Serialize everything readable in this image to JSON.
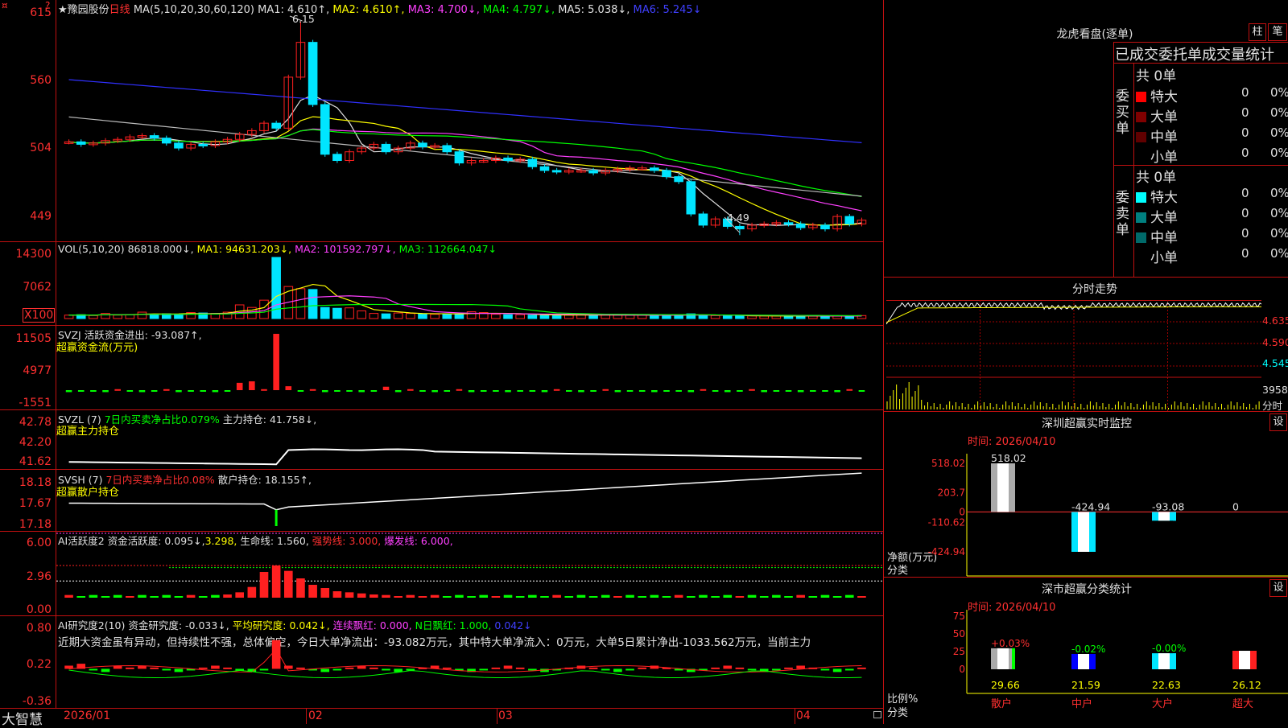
{
  "top_icons": {
    "left": "¤",
    "right": "?"
  },
  "main": {
    "star": "★",
    "stock_name": "豫园股份",
    "period": "日线",
    "ma_label": "MA(5,10,20,30,60,120)",
    "ma_values": [
      {
        "text": "MA1: 4.610↑,",
        "color": "#e0e0e0"
      },
      {
        "text": "MA2: 4.610↑,",
        "color": "#ffff00"
      },
      {
        "text": "MA3: 4.700↓,",
        "color": "#ff40ff"
      },
      {
        "text": "MA4: 4.797↓,",
        "color": "#00ff00"
      },
      {
        "text": "MA5: 5.038↓,",
        "color": "#e0e0e0"
      },
      {
        "text": "MA6: 5.245↓",
        "color": "#4040ff"
      }
    ],
    "y_ticks": [
      "615",
      "560",
      "504",
      "449"
    ],
    "high_label": "6.15",
    "low_label": "4.49"
  },
  "vol": {
    "label": "VOL(5,10,20)",
    "value": "86818.000↓,",
    "ma": [
      {
        "text": "MA1: 94631.203↓,",
        "color": "#ffff00"
      },
      {
        "text": "MA2: 101592.797↓,",
        "color": "#ff40ff"
      },
      {
        "text": "MA3: 112664.047↓",
        "color": "#00ff00"
      }
    ],
    "y_ticks": [
      "14300",
      "7062"
    ],
    "unit": "X100"
  },
  "svzj": {
    "line1": "SVZJ  活跃资金进出: -93.087↑,",
    "line2": "超赢资金流(万元)",
    "y_ticks": [
      "11505",
      "4977",
      "-1551"
    ]
  },
  "svzl": {
    "name": "SVZL (7)",
    "ratio": "7日内买卖净占比0.079%",
    "hold": "主力持仓: 41.758↓,",
    "line2": "超赢主力持仓",
    "y_ticks": [
      "42.78",
      "42.20",
      "41.62"
    ]
  },
  "svsh": {
    "name": "SVSH (7)",
    "ratio": "7日内买卖净占比0.08%",
    "hold": "散户持仓: 18.155↑,",
    "line2": "超赢散户持仓",
    "y_ticks": [
      "18.18",
      "17.67",
      "17.18"
    ]
  },
  "ai1": {
    "name": "AI活跃度2",
    "a": "资金活跃度: 0.095↓,",
    "b": "3.298,",
    "c": "生命线: 1.560,",
    "d": "强势线: 3.000,",
    "e": "爆发线: 6.000,",
    "y_ticks": [
      "6.00",
      "2.96",
      "0.00"
    ]
  },
  "ai2": {
    "name": "AI研究度2(10)",
    "a": "资金研究度: -0.033↓,",
    "b": "平均研究度: 0.042↓,",
    "c": "连续飘红: 0.000,",
    "d": "N日飘红: 1.000,",
    "e": "0.042↓",
    "comment": "近期大资金虽有异动，但持续性不强，总体偏空，今日大单净流出：-93.082万元，其中特大单净流入：0万元，大单5日累计净出-1033.562万元，当前主力",
    "y_ticks": [
      "0.80",
      "0.22",
      "-0.36"
    ]
  },
  "xaxis": {
    "brand": "大智慧",
    "labels": [
      "2026/01",
      "02",
      "03",
      "04"
    ]
  },
  "right": {
    "dragon_title": "龙虎看盘(逐单)",
    "btn_bar": "柱",
    "btn_pen": "笔",
    "stats_header": "已成交委托单成交量统计",
    "buy": {
      "side": "委买单",
      "total": "共 0单",
      "rows": [
        {
          "name": "特大",
          "count": "0",
          "pct": "0%",
          "color": "#ff0000"
        },
        {
          "name": "大单",
          "count": "0",
          "pct": "0%",
          "color": "#800000"
        },
        {
          "name": "中单",
          "count": "0",
          "pct": "0%",
          "color": "#600000"
        },
        {
          "name": "小单",
          "count": "0",
          "pct": "0%",
          "color": ""
        }
      ]
    },
    "sell": {
      "side": "委卖单",
      "total": "共 0单",
      "rows": [
        {
          "name": "特大",
          "count": "0",
          "pct": "0%",
          "color": "#00ffff"
        },
        {
          "name": "大单",
          "count": "0",
          "pct": "0%",
          "color": "#008080"
        },
        {
          "name": "中单",
          "count": "0",
          "pct": "0%",
          "color": "#006a6a"
        },
        {
          "name": "小单",
          "count": "0",
          "pct": "0%",
          "color": ""
        }
      ]
    },
    "intraday": {
      "title": "分时走势",
      "ticks": [
        "4.635",
        "4.590",
        "4.545"
      ],
      "vol_tick": "3958",
      "vol_label": "分时"
    },
    "sz_monitor": {
      "title": "深圳超赢实时监控",
      "btn": "设",
      "time": "时间: 2026/04/10",
      "y_ticks": [
        "518.02",
        "203.7",
        "0",
        "-110.62",
        "-424.94"
      ],
      "bars": [
        {
          "cat": "散户",
          "value": 518.02,
          "label": "518.02"
        },
        {
          "cat": "中户",
          "value": -424.94,
          "label": "-424.94"
        },
        {
          "cat": "大户",
          "value": -93.08,
          "label": "-93.08"
        },
        {
          "cat": "超大",
          "value": 0,
          "label": "0"
        }
      ],
      "ylabel": "净额(万元)",
      "xlabel": "分类"
    },
    "sz_class": {
      "title": "深市超赢分类统计",
      "btn": "设",
      "time": "时间: 2026/04/10",
      "y_ticks": [
        "75",
        "50",
        "25",
        "0"
      ],
      "bars": [
        {
          "cat": "散户",
          "value": 29.66,
          "label": "29.66",
          "delta": "+0.03%"
        },
        {
          "cat": "中户",
          "value": 21.59,
          "label": "21.59",
          "delta": "-0.02%"
        },
        {
          "cat": "大户",
          "value": 22.63,
          "label": "22.63",
          "delta": "-0.00%"
        },
        {
          "cat": "超大",
          "value": 26.12,
          "label": "26.12",
          "delta": ""
        }
      ],
      "ylabel": "比例%",
      "xlabel": "分类"
    }
  },
  "chart_data": {
    "type": "candlestick",
    "dates_axis": [
      "2026/01",
      "02",
      "03",
      "04"
    ],
    "close": [
      5.2,
      5.18,
      5.19,
      5.21,
      5.22,
      5.24,
      5.25,
      5.23,
      5.19,
      5.15,
      5.18,
      5.17,
      5.2,
      5.22,
      5.26,
      5.29,
      5.35,
      5.31,
      5.72,
      6.0,
      5.5,
      5.1,
      5.05,
      5.12,
      5.15,
      5.18,
      5.12,
      5.15,
      5.19,
      5.16,
      5.17,
      5.12,
      5.03,
      5.05,
      5.05,
      5.07,
      5.05,
      5.06,
      5.0,
      4.97,
      4.96,
      4.97,
      4.97,
      4.95,
      4.97,
      4.98,
      4.99,
      4.99,
      4.97,
      4.92,
      4.88,
      4.62,
      4.53,
      4.58,
      4.52,
      4.5,
      4.53,
      4.54,
      4.55,
      4.54,
      4.51,
      4.53,
      4.5,
      4.6,
      4.54,
      4.57
    ],
    "volume_x100": [
      800,
      900,
      700,
      1200,
      800,
      900,
      1500,
      1000,
      1100,
      900,
      1400,
      1300,
      1200,
      1500,
      3200,
      2600,
      4300,
      14300,
      7500,
      7000,
      6800,
      2600,
      2400,
      2500,
      1800,
      1200,
      1100,
      1300,
      1200,
      1100,
      1000,
      1000,
      1100,
      1600,
      1400,
      1000,
      900,
      900,
      800,
      800,
      800,
      800,
      850,
      900,
      800,
      800,
      800,
      800,
      700,
      700,
      900,
      1100,
      800,
      700,
      600,
      600,
      600,
      600,
      600,
      600,
      600,
      600,
      600,
      600,
      600,
      700
    ]
  }
}
